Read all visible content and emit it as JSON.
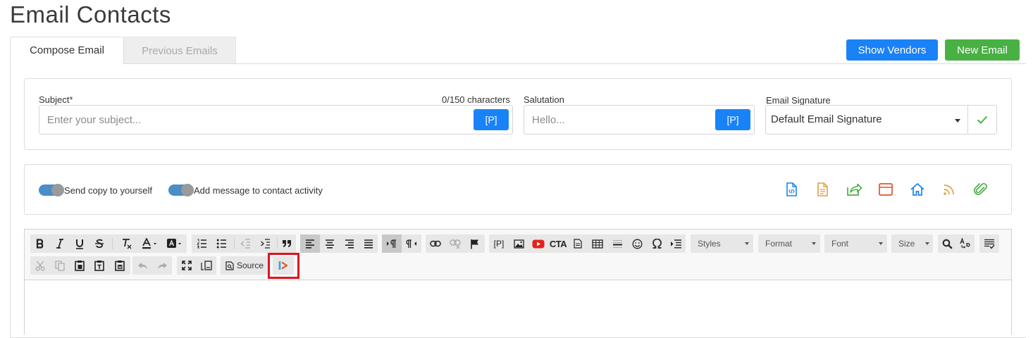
{
  "page": {
    "title": "Email Contacts"
  },
  "tabs": [
    {
      "label": "Compose Email",
      "active": true
    },
    {
      "label": "Previous Emails",
      "active": false
    }
  ],
  "header_buttons": {
    "show_vendors": "Show Vendors",
    "new_email": "New Email"
  },
  "colors": {
    "primary": "#1a82f7",
    "success": "#49b043",
    "toggle_track": "#4a8ec7",
    "highlight": "#e0141e"
  },
  "compose": {
    "subject": {
      "label": "Subject*",
      "counter": "0/150 characters",
      "placeholder": "Enter your subject...",
      "placeholder_button": "[P]"
    },
    "salutation": {
      "label": "Salutation",
      "placeholder": "Hello...",
      "placeholder_button": "[P]"
    },
    "signature": {
      "label": "Email Signature",
      "value": "Default Email Signature"
    }
  },
  "options": {
    "send_copy": {
      "label": "Send copy to yourself",
      "on": true
    },
    "add_activity": {
      "label": "Add message to contact activity",
      "on": true
    }
  },
  "action_icons": [
    "html-file-icon",
    "document-icon",
    "share-icon",
    "browser-window-icon",
    "home-icon",
    "rss-icon",
    "paperclip-icon"
  ],
  "editor": {
    "dropdowns": {
      "styles": "Styles",
      "format": "Format",
      "font": "Font",
      "size": "Size"
    },
    "source_label": "Source",
    "placeholder_label": "[P]",
    "cta_label": "CTA"
  }
}
